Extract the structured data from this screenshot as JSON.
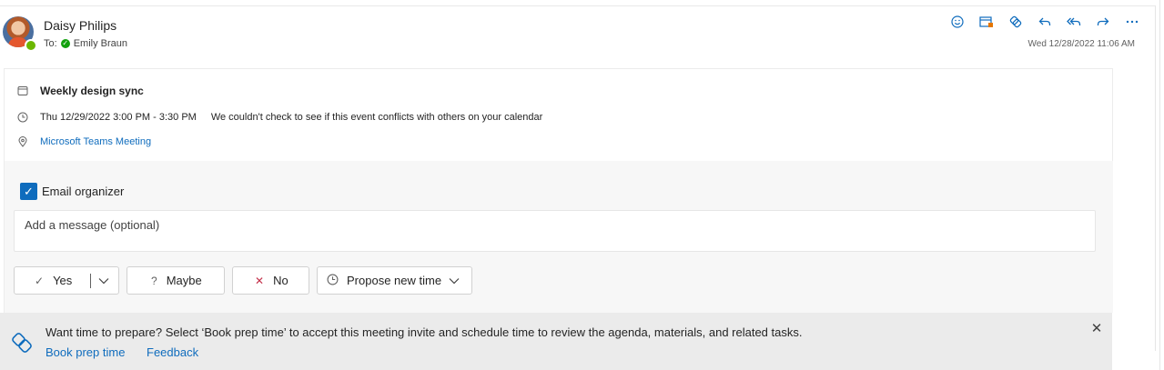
{
  "header": {
    "sender_name": "Daisy Philips",
    "to_prefix": "To:",
    "recipient": "Emily Braun",
    "date": "Wed 12/28/2022 11:06 AM",
    "toolbar_icons": [
      "emoji-icon",
      "calendar-flag-icon",
      "prep-icon",
      "reply-icon",
      "reply-all-icon",
      "forward-icon",
      "more-icon"
    ]
  },
  "event": {
    "title": "Weekly design sync",
    "time": "Thu 12/29/2022 3:00 PM - 3:30 PM",
    "conflict_note": "We couldn't check to see if this event conflicts with others on your calendar",
    "location_link": "Microsoft Teams Meeting"
  },
  "response": {
    "email_organizer_label": "Email organizer",
    "email_organizer_checked": true,
    "message_placeholder": "Add a message (optional)",
    "buttons": {
      "yes": "Yes",
      "maybe": "Maybe",
      "no": "No",
      "propose": "Propose new time"
    }
  },
  "banner": {
    "text": "Want time to prepare? Select ‘Book prep time’ to accept this meeting invite and schedule time to review the agenda, materials, and related tasks.",
    "book_link": "Book prep time",
    "feedback_link": "Feedback"
  },
  "colors": {
    "accent": "#0f6cbd",
    "presence": "#6bb700",
    "panel_bg": "#f7f7f7",
    "banner_bg": "#ebebeb"
  }
}
